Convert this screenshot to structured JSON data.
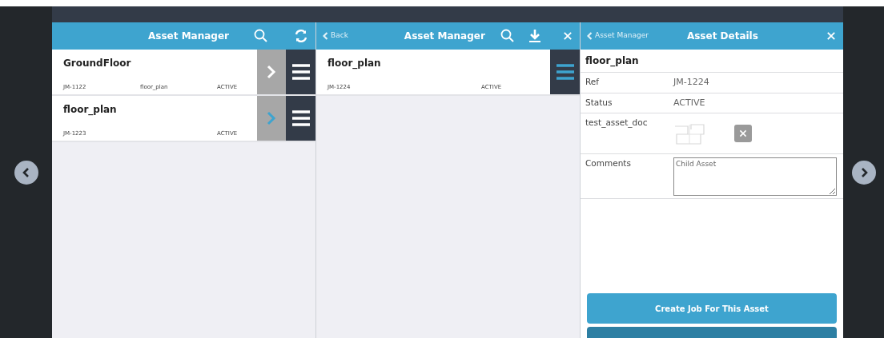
{
  "list_panel": {
    "title": "Asset Manager",
    "rows": [
      {
        "name": "GroundFloor",
        "ref": "JM-1122",
        "parent": "floor_plan",
        "status": "ACTIVE",
        "selected": false
      },
      {
        "name": "floor_plan",
        "ref": "JM-1223",
        "status": "ACTIVE",
        "selected": true
      }
    ]
  },
  "child_panel": {
    "back": "Back",
    "title": "Asset Manager",
    "rows": [
      {
        "name": "floor_plan",
        "ref": "JM-1224",
        "status": "ACTIVE"
      }
    ]
  },
  "details_panel": {
    "back": "Asset Manager",
    "title": "Asset Details",
    "heading": "floor_plan",
    "fields": [
      {
        "kind": "text",
        "label": "Ref",
        "value": "JM-1224"
      },
      {
        "kind": "text",
        "label": "Status",
        "value": "ACTIVE"
      },
      {
        "kind": "attachment",
        "label": "test_asset_doc"
      },
      {
        "kind": "textarea",
        "label": "Comments",
        "value": "Child Asset"
      }
    ],
    "button": "Create Job For This Asset"
  }
}
